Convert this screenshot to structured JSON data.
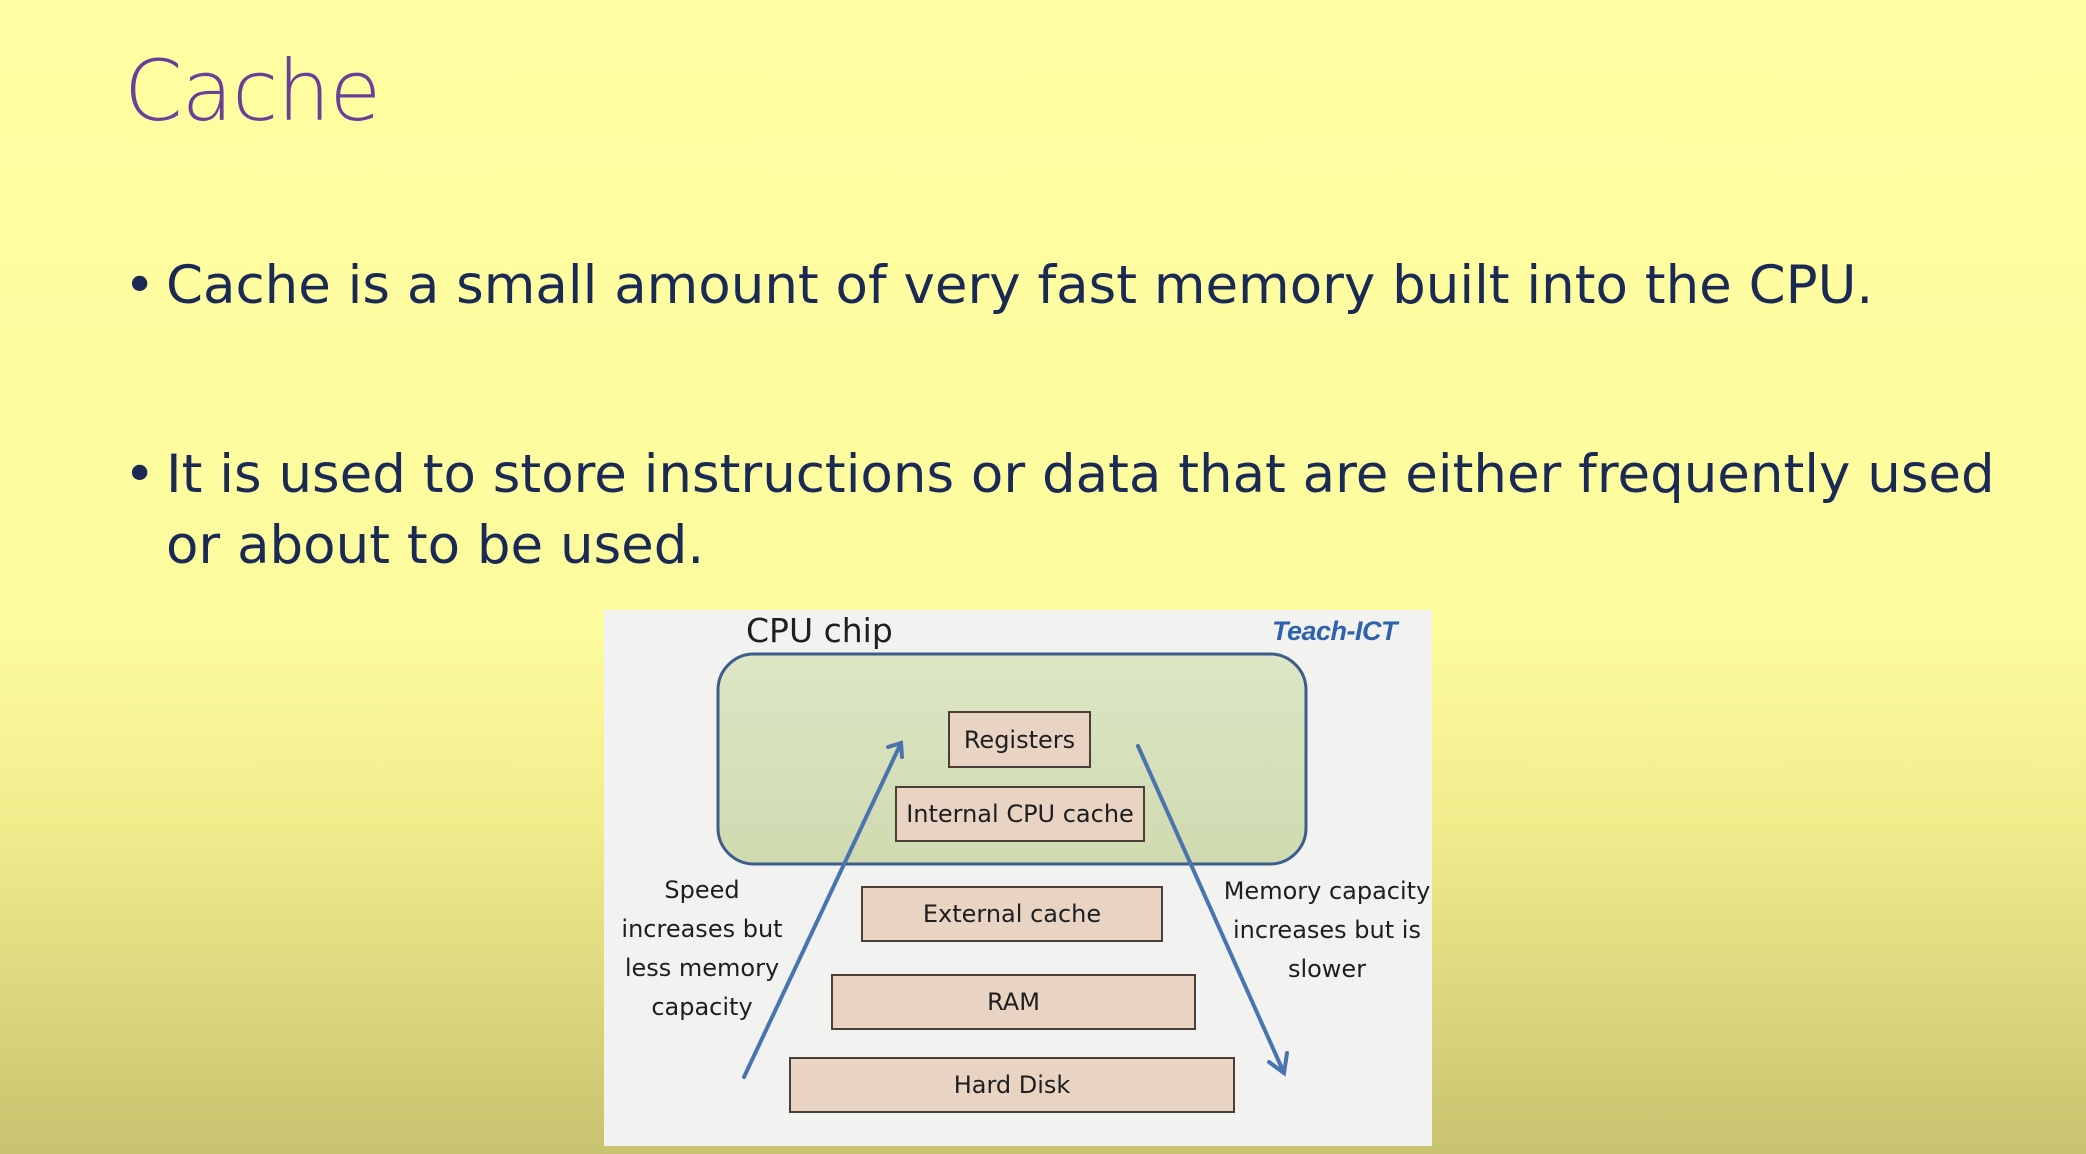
{
  "slide": {
    "title": "Cache",
    "bullets": [
      "Cache is a small amount of very fast memory built into the CPU.",
      "It is used to store instructions or data that are either frequently used or about to be used."
    ]
  },
  "diagram": {
    "chip_label": "CPU chip",
    "brand": "Teach-ICT",
    "levels": [
      "Registers",
      "Internal CPU cache",
      "External cache",
      "RAM",
      "Hard Disk"
    ],
    "left_note": "Speed increases but less memory capacity",
    "right_note": "Memory capacity increases but is slower",
    "colors": {
      "chip_fill": "#dbe3c2",
      "chip_border": "#3f5d8a",
      "box_fill": "#e9d4c4",
      "arrow": "#4a74ad"
    }
  }
}
